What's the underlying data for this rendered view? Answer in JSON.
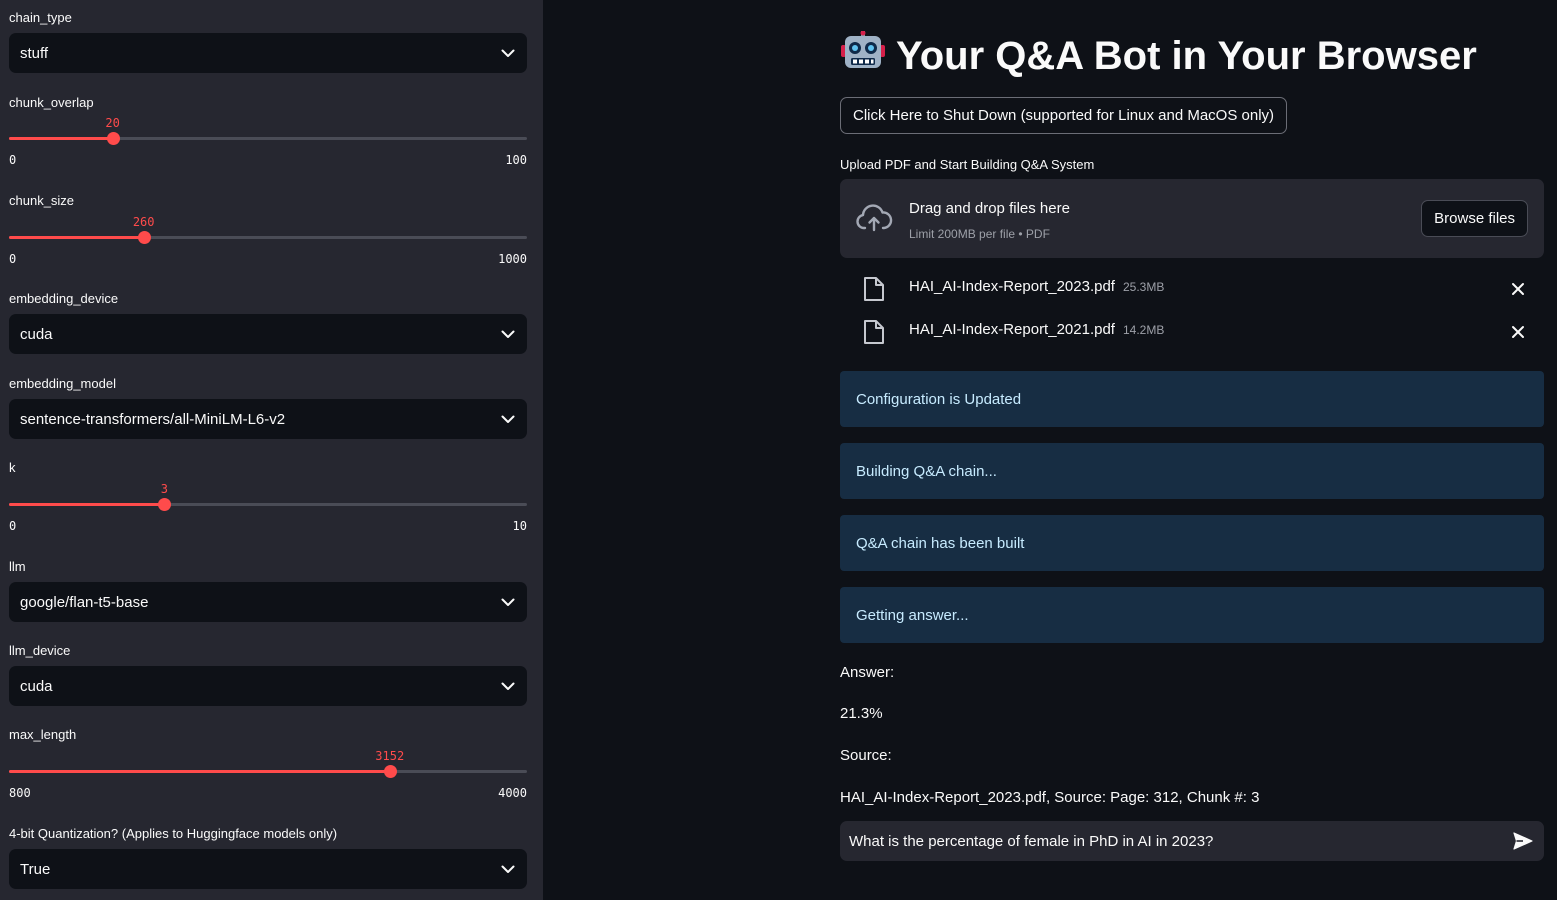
{
  "sidebar": {
    "chain_type": {
      "label": "chain_type",
      "value": "stuff"
    },
    "chunk_overlap": {
      "label": "chunk_overlap",
      "value": 20,
      "value_text": "20",
      "min": 0,
      "max": 100,
      "min_text": "0",
      "max_text": "100"
    },
    "chunk_size": {
      "label": "chunk_size",
      "value": 260,
      "value_text": "260",
      "min": 0,
      "max": 1000,
      "min_text": "0",
      "max_text": "1000"
    },
    "embedding_device": {
      "label": "embedding_device",
      "value": "cuda"
    },
    "embedding_model": {
      "label": "embedding_model",
      "value": "sentence-transformers/all-MiniLM-L6-v2"
    },
    "k": {
      "label": "k",
      "value": 3,
      "value_text": "3",
      "min": 0,
      "max": 10,
      "min_text": "0",
      "max_text": "10"
    },
    "llm": {
      "label": "llm",
      "value": "google/flan-t5-base"
    },
    "llm_device": {
      "label": "llm_device",
      "value": "cuda"
    },
    "max_length": {
      "label": "max_length",
      "value": 3152,
      "value_text": "3152",
      "min": 800,
      "max": 4000,
      "min_text": "800",
      "max_text": "4000"
    },
    "quantization": {
      "label": "4-bit Quantization? (Applies to Huggingface models only)",
      "value": "True"
    }
  },
  "main": {
    "title_emoji": "🤖",
    "title": "Your Q&A Bot in Your Browser",
    "shutdown_label": "Click Here to Shut Down (supported for Linux and MacOS only)",
    "upload_label": "Upload PDF and Start Building Q&A System",
    "dropzone": {
      "main_text": "Drag and drop files here",
      "sub_text": "Limit 200MB per file • PDF",
      "browse_label": "Browse files"
    },
    "files": [
      {
        "name": "HAI_AI-Index-Report_2023.pdf",
        "size": "25.3MB"
      },
      {
        "name": "HAI_AI-Index-Report_2021.pdf",
        "size": "14.2MB"
      }
    ],
    "alerts": [
      "Configuration is Updated",
      "Building Q&A chain...",
      "Q&A chain has been built",
      "Getting answer..."
    ],
    "answer_label": "Answer:",
    "answer_value": "21.3%",
    "source_label": "Source:",
    "source_value": "HAI_AI-Index-Report_2023.pdf, Source: Page: 312, Chunk #: 3",
    "chat_input_value": "What is the percentage of female in PhD in AI in 2023?"
  },
  "colors": {
    "accent": "#ff4b4b",
    "sidebar_bg": "#262730",
    "main_bg": "#0e1117",
    "info_bg": "#172d43",
    "info_text": "#c7ebff"
  },
  "icons": {
    "select_chevron": "chevron-down-icon",
    "upload": "cloud-upload-icon",
    "file": "file-icon",
    "remove": "close-icon",
    "send": "send-icon"
  }
}
